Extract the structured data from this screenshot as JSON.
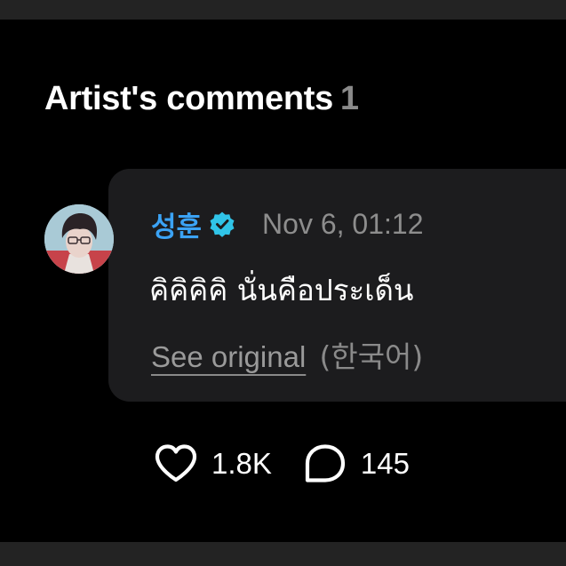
{
  "section": {
    "title": "Artist's comments",
    "count": "1"
  },
  "comment": {
    "author": "성훈",
    "verified_icon": "verified-badge-icon",
    "timestamp": "Nov 6, 01:12",
    "text": "คิคิคิคิ นั่นคือประเด็น",
    "see_original_label": "See original",
    "original_language": "(한국어)",
    "likes": "1.8K",
    "replies": "145"
  },
  "colors": {
    "background": "#000000",
    "bubble": "#1c1c1e",
    "author": "#3ba3f5",
    "verified": "#30c4e8",
    "muted": "#8a8a8a",
    "divider": "#232323"
  },
  "icons": {
    "like": "heart-icon",
    "reply": "comment-bubble-icon"
  }
}
